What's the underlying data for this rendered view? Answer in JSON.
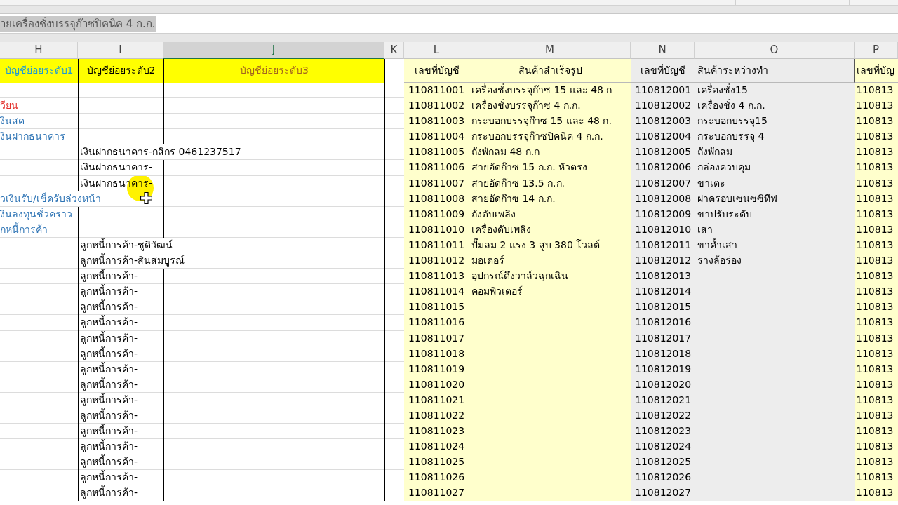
{
  "formula_bar": {
    "value": "ายเครื่องชั่งบรรจุก๊าซปิคนิค 4 ก.ก.",
    "highlighted": true
  },
  "columns": [
    {
      "letter": "H",
      "selected": false
    },
    {
      "letter": "I",
      "selected": false
    },
    {
      "letter": "J",
      "selected": true
    },
    {
      "letter": "K",
      "selected": false
    },
    {
      "letter": "L",
      "selected": false
    },
    {
      "letter": "M",
      "selected": false
    },
    {
      "letter": "N",
      "selected": false
    },
    {
      "letter": "O",
      "selected": false
    },
    {
      "letter": "P",
      "selected": false
    }
  ],
  "header_row": {
    "H": "บัญชีย่อยระดับ1",
    "I": "บัญชีย่อยระดับ2",
    "J": "บัญชีย่อยระดับ3",
    "L": "เลขที่บัญชี",
    "M": "สินค้าสำเร็จรูป",
    "N": "เลขที่บัญชี",
    "O": "สินค้าระหว่างทำ",
    "P": "เลขที่บัญ"
  },
  "rows": [
    {
      "L": "110811001",
      "M": "เครื่องชั่งบรรจุก๊าซ 15 และ 48 ก",
      "N": "110812001",
      "O": "เครื่องชั่ง15",
      "P": "110813"
    },
    {
      "H": {
        "text": "วียน",
        "kind": "group"
      },
      "L": "110811002",
      "M": "เครื่องชั่งบรรจุก๊าซ 4 ก.ก.",
      "N": "110812002",
      "O": "เครื่องชั่ง 4 ก.ก.",
      "P": "110813"
    },
    {
      "H": {
        "text": "งินสด",
        "kind": "account"
      },
      "L": "110811003",
      "M": "กระบอกบรรจุก๊าซ 15 และ 48 ก.",
      "N": "110812003",
      "O": "กระบอกบรรจุ15",
      "P": "110813"
    },
    {
      "H": {
        "text": "งินฝากธนาคาร",
        "kind": "account"
      },
      "L": "110811004",
      "M": "กระบอกบรรจุก๊าซปิคนิค 4 ก.ก.",
      "N": "110812004",
      "O": "กระบอกบรรจุ 4",
      "P": "110813"
    },
    {
      "I": "เงินฝากธนาคาร-กสิกร 0461237517",
      "L": "110811005",
      "M": "ถังพักลม 48 ก.ก",
      "N": "110812005",
      "O": "ถังพักลม",
      "P": "110813"
    },
    {
      "I": "เงินฝากธนาคาร-",
      "L": "110811006",
      "M": "สายอัดก๊าซ 15 ก.ก. หัวตรง",
      "N": "110812006",
      "O": "กล่องควบคุม",
      "P": "110813"
    },
    {
      "I": "เงินฝากธนาคาร-",
      "L": "110811007",
      "M": "สายอัดก๊าซ 13.5 ก.ก.",
      "N": "110812007",
      "O": "ขาเตะ",
      "P": "110813"
    },
    {
      "H": {
        "text": "วเงินรับ/เช็ครับล่วงหน้า",
        "kind": "account"
      },
      "L": "110811008",
      "M": "สายอัดก๊าซ 14 ก.ก.",
      "N": "110812008",
      "O": "ฝาครอบเซนซซิทีฟ",
      "P": "110813"
    },
    {
      "H": {
        "text": "งินลงทุนชั่วคราว",
        "kind": "account"
      },
      "L": "110811009",
      "M": "ถังดับเพลิง",
      "N": "110812009",
      "O": "ขาปรับระดับ",
      "P": "110813"
    },
    {
      "H": {
        "text": "กหนี้การค้า",
        "kind": "account"
      },
      "L": "110811010",
      "M": "เครื่องดับเพลิง",
      "N": "110812010",
      "O": "เสา",
      "P": "110813"
    },
    {
      "I": "ลูกหนี้การค้า-ชูดิวัฒน์",
      "L": "110811011",
      "M": "ปั๊มลม 2 แรง 3 สูบ 380 โวลต์",
      "N": "110812011",
      "O": "ขาค้ำเสา",
      "P": "110813"
    },
    {
      "I": "ลูกหนี้การค้า-สินสมบูรณ์",
      "L": "110811012",
      "M": "มอเตอร์",
      "N": "110812012",
      "O": "รางล้อร่อง",
      "P": "110813"
    },
    {
      "I": "ลูกหนี้การค้า-",
      "L": "110811013",
      "M": "อุปกรณ์ดึงวาล์วฉุกเฉิน",
      "N": "110812013",
      "P": "110813"
    },
    {
      "I": "ลูกหนี้การค้า-",
      "L": "110811014",
      "M": "คอมพิวเตอร์",
      "N": "110812014",
      "P": "110813"
    },
    {
      "I": "ลูกหนี้การค้า-",
      "L": "110811015",
      "N": "110812015",
      "P": "110813"
    },
    {
      "I": "ลูกหนี้การค้า-",
      "L": "110811016",
      "N": "110812016",
      "P": "110813"
    },
    {
      "I": "ลูกหนี้การค้า-",
      "L": "110811017",
      "N": "110812017",
      "P": "110813"
    },
    {
      "I": "ลูกหนี้การค้า-",
      "L": "110811018",
      "N": "110812018",
      "P": "110813"
    },
    {
      "I": "ลูกหนี้การค้า-",
      "L": "110811019",
      "N": "110812019",
      "P": "110813"
    },
    {
      "I": "ลูกหนี้การค้า-",
      "L": "110811020",
      "N": "110812020",
      "P": "110813"
    },
    {
      "I": "ลูกหนี้การค้า-",
      "L": "110811021",
      "N": "110812021",
      "P": "110813"
    },
    {
      "I": "ลูกหนี้การค้า-",
      "L": "110811022",
      "N": "110812022",
      "P": "110813"
    },
    {
      "I": "ลูกหนี้การค้า-",
      "L": "110811023",
      "N": "110812023",
      "P": "110813"
    },
    {
      "I": "ลูกหนี้การค้า-",
      "L": "110811024",
      "N": "110812024",
      "P": "110813"
    },
    {
      "I": "ลูกหนี้การค้า-",
      "L": "110811025",
      "N": "110812025",
      "P": "110813"
    },
    {
      "I": "ลูกหนี้การค้า-",
      "L": "110811026",
      "N": "110812026",
      "P": "110813"
    },
    {
      "I": "ลูกหนี้การค้า-",
      "L": "110811027",
      "N": "110812027",
      "P": "110813"
    }
  ]
}
